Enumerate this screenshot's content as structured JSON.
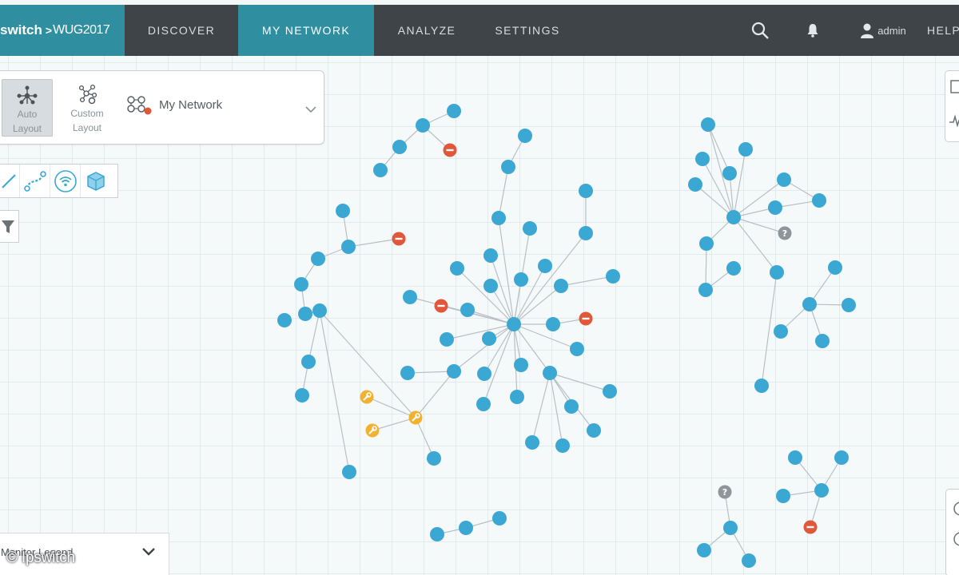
{
  "brand": {
    "name": "switch",
    "separator": ">",
    "product": "WUG2017"
  },
  "nav": {
    "discover": "DISCOVER",
    "my_network": "MY NETWORK",
    "analyze": "ANALYZE",
    "settings": "SETTINGS",
    "user": "admin",
    "help": "HELP"
  },
  "icons": {
    "search": "search-icon",
    "bell": "bell-icon",
    "user": "user-icon"
  },
  "layout_panel": {
    "auto_line1": "Auto",
    "auto_line2": "Layout",
    "custom_line1": "Custom",
    "custom_line2": "Layout",
    "network_name": "My Network"
  },
  "legend": {
    "label": "Monitor Legend"
  },
  "watermark": "© Ipswitch",
  "colors": {
    "accent": "#2f8fa0",
    "topbar": "#3f4448",
    "device": "#3ba8d3",
    "down": "#e0573a",
    "maintenance": "#f2b12f",
    "unknown": "#8f969a",
    "link": "#b8c0c4"
  },
  "network": {
    "ok": [
      [
        568,
        139
      ],
      [
        529,
        157
      ],
      [
        500,
        184
      ],
      [
        476,
        213
      ],
      [
        657,
        170
      ],
      [
        636,
        209
      ],
      [
        429,
        264
      ],
      [
        436,
        309
      ],
      [
        398,
        324
      ],
      [
        377,
        356
      ],
      [
        356,
        401
      ],
      [
        382,
        393
      ],
      [
        400,
        389
      ],
      [
        386,
        453
      ],
      [
        378,
        495
      ],
      [
        437,
        591
      ],
      [
        733,
        239
      ],
      [
        733,
        292
      ],
      [
        624,
        273
      ],
      [
        663,
        286
      ],
      [
        614,
        320
      ],
      [
        572,
        336
      ],
      [
        614,
        358
      ],
      [
        652,
        350
      ],
      [
        682,
        333
      ],
      [
        702,
        358
      ],
      [
        767,
        346
      ],
      [
        513,
        372
      ],
      [
        585,
        388
      ],
      [
        643,
        406
      ],
      [
        692,
        406
      ],
      [
        559,
        425
      ],
      [
        612,
        424
      ],
      [
        722,
        437
      ],
      [
        510,
        467
      ],
      [
        568,
        465
      ],
      [
        606,
        468
      ],
      [
        652,
        457
      ],
      [
        688,
        467
      ],
      [
        763,
        490
      ],
      [
        605,
        506
      ],
      [
        647,
        497
      ],
      [
        715,
        509
      ],
      [
        743,
        539
      ],
      [
        666,
        554
      ],
      [
        704,
        558
      ],
      [
        543,
        574
      ],
      [
        547,
        669
      ],
      [
        583,
        661
      ],
      [
        625,
        649
      ],
      [
        886,
        156
      ],
      [
        933,
        187
      ],
      [
        879,
        199
      ],
      [
        913,
        217
      ],
      [
        870,
        231
      ],
      [
        981,
        225
      ],
      [
        1025,
        251
      ],
      [
        970,
        260
      ],
      [
        918,
        272
      ],
      [
        884,
        305
      ],
      [
        918,
        336
      ],
      [
        883,
        363
      ],
      [
        972,
        341
      ],
      [
        1045,
        335
      ],
      [
        1013,
        381
      ],
      [
        1062,
        382
      ],
      [
        977,
        415
      ],
      [
        1029,
        427
      ],
      [
        953,
        483
      ],
      [
        995,
        573
      ],
      [
        1053,
        573
      ],
      [
        1028,
        614
      ],
      [
        980,
        621
      ],
      [
        914,
        661
      ],
      [
        881,
        689
      ],
      [
        937,
        702
      ]
    ],
    "down": [
      [
        563,
        188
      ],
      [
        499,
        299
      ],
      [
        552,
        383
      ],
      [
        733,
        399
      ],
      [
        1014,
        660
      ]
    ],
    "maintenance": [
      [
        459,
        497
      ],
      [
        520,
        523
      ],
      [
        466,
        539
      ]
    ],
    "unknown": [
      [
        982,
        292
      ],
      [
        907,
        616
      ]
    ],
    "links": [
      [
        [
          568,
          139
        ],
        [
          529,
          157
        ]
      ],
      [
        [
          529,
          157
        ],
        [
          500,
          184
        ]
      ],
      [
        [
          500,
          184
        ],
        [
          476,
          213
        ]
      ],
      [
        [
          529,
          157
        ],
        [
          563,
          188
        ]
      ],
      [
        [
          657,
          170
        ],
        [
          636,
          209
        ]
      ],
      [
        [
          636,
          209
        ],
        [
          624,
          273
        ]
      ],
      [
        [
          429,
          264
        ],
        [
          436,
          309
        ]
      ],
      [
        [
          436,
          309
        ],
        [
          499,
          299
        ]
      ],
      [
        [
          436,
          309
        ],
        [
          398,
          324
        ]
      ],
      [
        [
          398,
          324
        ],
        [
          377,
          356
        ]
      ],
      [
        [
          377,
          356
        ],
        [
          382,
          393
        ]
      ],
      [
        [
          382,
          393
        ],
        [
          400,
          389
        ]
      ],
      [
        [
          400,
          389
        ],
        [
          386,
          453
        ]
      ],
      [
        [
          386,
          453
        ],
        [
          378,
          495
        ]
      ],
      [
        [
          400,
          389
        ],
        [
          437,
          591
        ]
      ],
      [
        [
          400,
          389
        ],
        [
          520,
          523
        ]
      ],
      [
        [
          520,
          523
        ],
        [
          459,
          497
        ]
      ],
      [
        [
          520,
          523
        ],
        [
          466,
          539
        ]
      ],
      [
        [
          520,
          523
        ],
        [
          543,
          574
        ]
      ],
      [
        [
          520,
          523
        ],
        [
          568,
          465
        ]
      ],
      [
        [
          568,
          465
        ],
        [
          510,
          467
        ]
      ],
      [
        [
          568,
          465
        ],
        [
          643,
          406
        ]
      ],
      [
        [
          733,
          239
        ],
        [
          733,
          292
        ]
      ],
      [
        [
          733,
          292
        ],
        [
          643,
          406
        ]
      ],
      [
        [
          643,
          406
        ],
        [
          624,
          273
        ]
      ],
      [
        [
          643,
          406
        ],
        [
          663,
          286
        ]
      ],
      [
        [
          643,
          406
        ],
        [
          614,
          320
        ]
      ],
      [
        [
          643,
          406
        ],
        [
          572,
          336
        ]
      ],
      [
        [
          643,
          406
        ],
        [
          614,
          358
        ]
      ],
      [
        [
          643,
          406
        ],
        [
          652,
          350
        ]
      ],
      [
        [
          643,
          406
        ],
        [
          682,
          333
        ]
      ],
      [
        [
          643,
          406
        ],
        [
          702,
          358
        ]
      ],
      [
        [
          702,
          358
        ],
        [
          767,
          346
        ]
      ],
      [
        [
          643,
          406
        ],
        [
          513,
          372
        ]
      ],
      [
        [
          643,
          406
        ],
        [
          585,
          388
        ]
      ],
      [
        [
          643,
          406
        ],
        [
          552,
          383
        ]
      ],
      [
        [
          643,
          406
        ],
        [
          692,
          406
        ]
      ],
      [
        [
          692,
          406
        ],
        [
          733,
          399
        ]
      ],
      [
        [
          643,
          406
        ],
        [
          559,
          425
        ]
      ],
      [
        [
          643,
          406
        ],
        [
          612,
          424
        ]
      ],
      [
        [
          643,
          406
        ],
        [
          722,
          437
        ]
      ],
      [
        [
          643,
          406
        ],
        [
          606,
          468
        ]
      ],
      [
        [
          643,
          406
        ],
        [
          652,
          457
        ]
      ],
      [
        [
          643,
          406
        ],
        [
          688,
          467
        ]
      ],
      [
        [
          643,
          406
        ],
        [
          605,
          506
        ]
      ],
      [
        [
          643,
          406
        ],
        [
          647,
          497
        ]
      ],
      [
        [
          688,
          467
        ],
        [
          763,
          490
        ]
      ],
      [
        [
          688,
          467
        ],
        [
          715,
          509
        ]
      ],
      [
        [
          688,
          467
        ],
        [
          743,
          539
        ]
      ],
      [
        [
          688,
          467
        ],
        [
          666,
          554
        ]
      ],
      [
        [
          688,
          467
        ],
        [
          704,
          558
        ]
      ],
      [
        [
          547,
          669
        ],
        [
          583,
          661
        ]
      ],
      [
        [
          583,
          661
        ],
        [
          625,
          649
        ]
      ],
      [
        [
          918,
          272
        ],
        [
          886,
          156
        ]
      ],
      [
        [
          918,
          272
        ],
        [
          933,
          187
        ]
      ],
      [
        [
          918,
          272
        ],
        [
          879,
          199
        ]
      ],
      [
        [
          918,
          272
        ],
        [
          913,
          217
        ]
      ],
      [
        [
          918,
          272
        ],
        [
          870,
          231
        ]
      ],
      [
        [
          918,
          272
        ],
        [
          981,
          225
        ]
      ],
      [
        [
          918,
          272
        ],
        [
          970,
          260
        ]
      ],
      [
        [
          918,
          272
        ],
        [
          982,
          292
        ]
      ],
      [
        [
          918,
          272
        ],
        [
          884,
          305
        ]
      ],
      [
        [
          918,
          272
        ],
        [
          972,
          341
        ]
      ],
      [
        [
          886,
          156
        ],
        [
          913,
          217
        ]
      ],
      [
        [
          981,
          225
        ],
        [
          1025,
          251
        ]
      ],
      [
        [
          970,
          260
        ],
        [
          1025,
          251
        ]
      ],
      [
        [
          884,
          305
        ],
        [
          883,
          363
        ]
      ],
      [
        [
          918,
          336
        ],
        [
          883,
          363
        ]
      ],
      [
        [
          972,
          341
        ],
        [
          953,
          483
        ]
      ],
      [
        [
          1013,
          381
        ],
        [
          1045,
          335
        ]
      ],
      [
        [
          1013,
          381
        ],
        [
          1062,
          382
        ]
      ],
      [
        [
          1013,
          381
        ],
        [
          977,
          415
        ]
      ],
      [
        [
          1013,
          381
        ],
        [
          1029,
          427
        ]
      ],
      [
        [
          1028,
          614
        ],
        [
          995,
          573
        ]
      ],
      [
        [
          1028,
          614
        ],
        [
          1053,
          573
        ]
      ],
      [
        [
          1028,
          614
        ],
        [
          980,
          621
        ]
      ],
      [
        [
          1028,
          614
        ],
        [
          1014,
          660
        ]
      ],
      [
        [
          907,
          616
        ],
        [
          914,
          661
        ]
      ],
      [
        [
          914,
          661
        ],
        [
          881,
          689
        ]
      ],
      [
        [
          914,
          661
        ],
        [
          937,
          702
        ]
      ]
    ]
  }
}
